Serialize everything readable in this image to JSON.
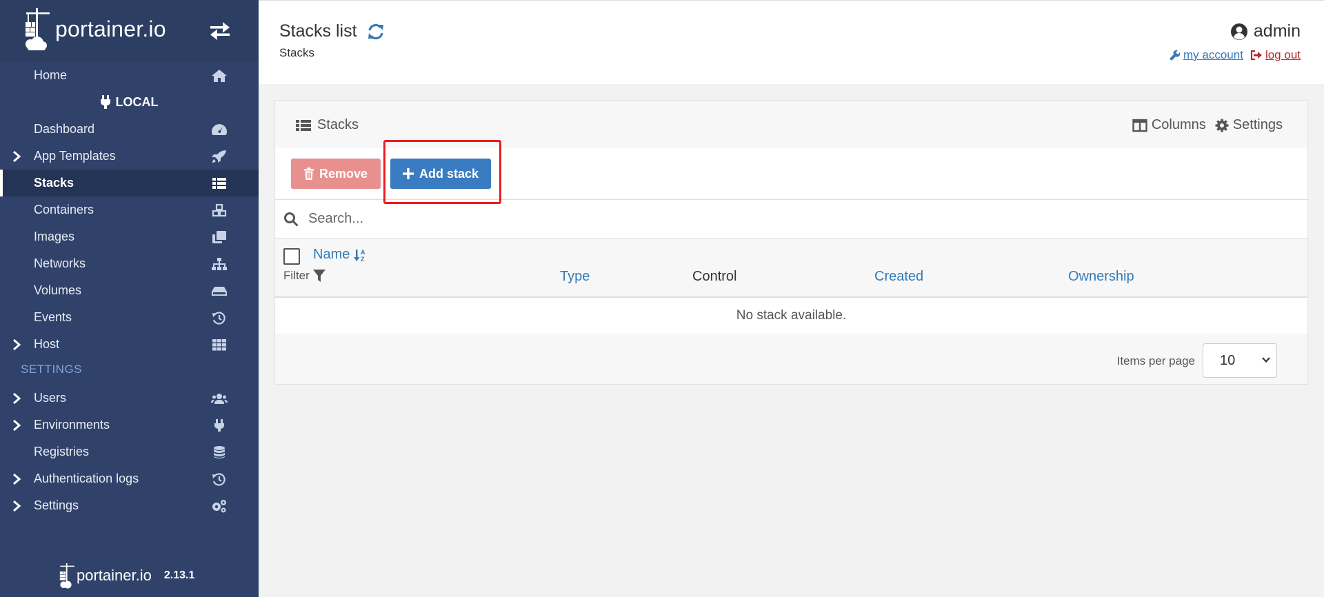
{
  "brand": {
    "logo_text": "portainer.io",
    "version": "2.13.1"
  },
  "sidebar": {
    "home_label": "Home",
    "environment_name": "LOCAL",
    "items": [
      {
        "label": "Dashboard",
        "icon": "tachometer-icon"
      },
      {
        "label": "App Templates",
        "icon": "rocket-icon",
        "expandable": true
      },
      {
        "label": "Stacks",
        "icon": "th-list-icon",
        "active": true
      },
      {
        "label": "Containers",
        "icon": "cubes-icon"
      },
      {
        "label": "Images",
        "icon": "clone-icon"
      },
      {
        "label": "Networks",
        "icon": "sitemap-icon"
      },
      {
        "label": "Volumes",
        "icon": "hdd-icon"
      },
      {
        "label": "Events",
        "icon": "history-icon"
      },
      {
        "label": "Host",
        "icon": "th-icon",
        "expandable": true
      }
    ],
    "settings_section_title": "SETTINGS",
    "settings_items": [
      {
        "label": "Users",
        "icon": "users-icon",
        "expandable": true
      },
      {
        "label": "Environments",
        "icon": "plug-icon",
        "expandable": true
      },
      {
        "label": "Registries",
        "icon": "database-icon"
      },
      {
        "label": "Authentication logs",
        "icon": "history-icon",
        "expandable": true
      },
      {
        "label": "Settings",
        "icon": "cogs-icon",
        "expandable": true
      }
    ]
  },
  "header": {
    "title": "Stacks list",
    "breadcrumb": "Stacks",
    "username": "admin",
    "my_account_label": "my account",
    "logout_label": "log out"
  },
  "widget": {
    "title": "Stacks",
    "columns_label": "Columns",
    "settings_label": "Settings",
    "remove_label": "Remove",
    "add_label": "Add stack",
    "search_placeholder": "Search...",
    "table": {
      "name_header": "Name",
      "filter_label": "Filter",
      "type_header": "Type",
      "control_header": "Control",
      "created_header": "Created",
      "ownership_header": "Ownership",
      "empty_message": "No stack available."
    },
    "items_per_page_label": "Items per page",
    "items_per_page_value": "10"
  },
  "colors": {
    "sidebar_bg": "#30426a",
    "primary": "#337ab7",
    "danger_light": "#e8908d",
    "highlight": "#ee1c1c"
  }
}
